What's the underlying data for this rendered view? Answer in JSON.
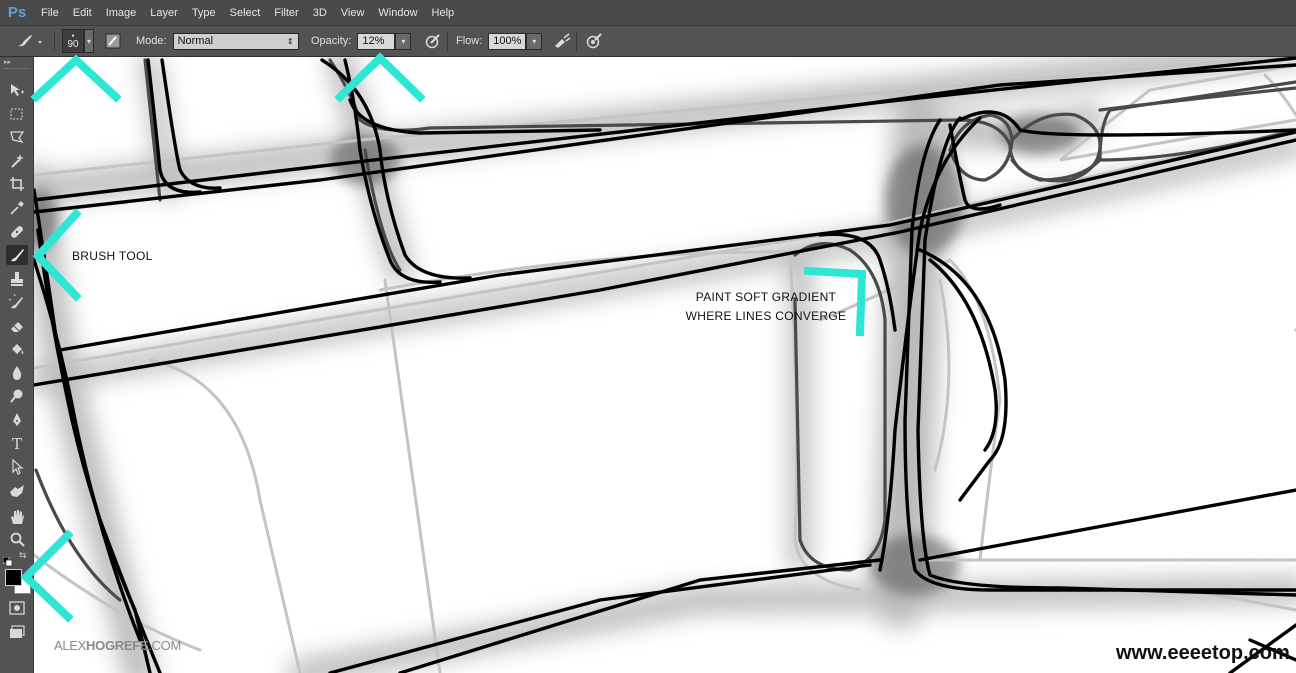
{
  "app": {
    "logo": "Ps"
  },
  "menu": [
    "File",
    "Edit",
    "Image",
    "Layer",
    "Type",
    "Select",
    "Filter",
    "3D",
    "View",
    "Window",
    "Help"
  ],
  "options": {
    "brush_size": "90",
    "mode_label": "Mode:",
    "mode_value": "Normal",
    "opacity_label": "Opacity:",
    "opacity_value": "12%",
    "flow_label": "Flow:",
    "flow_value": "100%"
  },
  "annotations": {
    "brush_tool": "BRUSH TOOL",
    "gradient_line1": "PAINT SOFT GRADIENT",
    "gradient_line2": "WHERE LINES CONVERGE"
  },
  "watermarks": {
    "left_prefix": "ALEX",
    "left_bold": "HOGREFE",
    "left_suffix": ".COM",
    "right": "www.eeeetop.com"
  },
  "colors": {
    "accent": "#2ee6d6",
    "foreground": "#000000",
    "background": "#ffffff"
  },
  "tools": [
    "move-tool-icon",
    "marquee-tool-icon",
    "lasso-tool-icon",
    "magic-wand-icon",
    "crop-tool-icon",
    "eyedropper-icon",
    "healing-brush-icon",
    "brush-tool-icon",
    "clone-stamp-icon",
    "history-brush-icon",
    "eraser-icon",
    "paint-bucket-icon",
    "blur-tool-icon",
    "dodge-tool-icon",
    "pen-tool-icon",
    "type-tool-icon",
    "path-selection-icon",
    "shape-tool-icon",
    "hand-tool-icon",
    "zoom-tool-icon"
  ]
}
